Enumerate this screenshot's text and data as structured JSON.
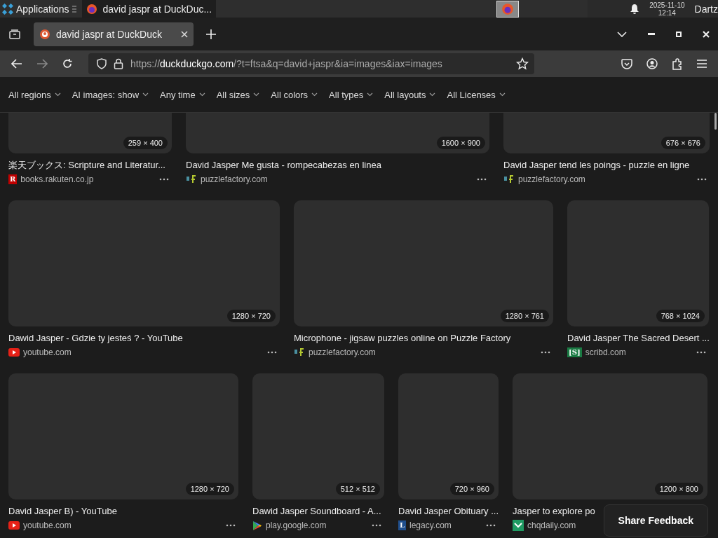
{
  "taskbar": {
    "apps_label": "Applications",
    "window_button": "david jaspr at DuckDuc...",
    "clock_date": "2025-11-10",
    "clock_time": "12:14",
    "user": "Dartz"
  },
  "browser": {
    "tab": {
      "title": "david jaspr at DuckDuck",
      "selected": true
    },
    "url": {
      "scheme": "https://",
      "host": "duckduckgo.com",
      "path": "/?t=ftsa&q=david+jaspr&ia=images&iax=images"
    }
  },
  "filters": [
    "All regions",
    "AI images: show",
    "Any time",
    "All sizes",
    "All colors",
    "All types",
    "All layouts",
    "All Licenses"
  ],
  "rows": [
    [
      {
        "size": "259 × 400",
        "title": "楽天ブックス: Scripture and Literatur...",
        "source": "books.rakuten.co.jp",
        "kind": "rakuten",
        "badge": "R"
      },
      {
        "size": "1600 × 900",
        "title": "David Jasper Me gusta - rompecabezas en linea",
        "source": "puzzlefactory.com",
        "kind": "puzzle"
      },
      {
        "size": "676 × 676",
        "title": "David Jasper tend les poings - puzzle en ligne",
        "source": "puzzlefactory.com",
        "kind": "puzzle"
      }
    ],
    [
      {
        "size": "1280 × 720",
        "title": "Dawid Jasper - Gdzie ty jesteś ? - YouTube",
        "source": "youtube.com",
        "kind": "youtube"
      },
      {
        "size": "1280 × 761",
        "title": "Microphone - jigsaw puzzles online on Puzzle Factory",
        "source": "puzzlefactory.com",
        "kind": "puzzle"
      },
      {
        "size": "768 × 1024",
        "title": "David Jasper The Sacred Desert ...",
        "source": "scribd.com",
        "kind": "scribd",
        "badge": "[S]"
      }
    ],
    [
      {
        "size": "1280 × 720",
        "title": "David Jasper B) - YouTube",
        "source": "youtube.com",
        "kind": "youtube"
      },
      {
        "size": "512 × 512",
        "title": "Dawid Jasper Soundboard - A...",
        "source": "play.google.com",
        "kind": "play"
      },
      {
        "size": "720 × 960",
        "title": "David Jasper Obituary ...",
        "source": "legacy.com",
        "kind": "legacy",
        "badge": "L"
      },
      {
        "size": "1200 × 800",
        "title": "Jasper to explore po",
        "source": "chqdaily.com",
        "kind": "chq"
      }
    ]
  ],
  "feedback_button": "Share Feedback"
}
